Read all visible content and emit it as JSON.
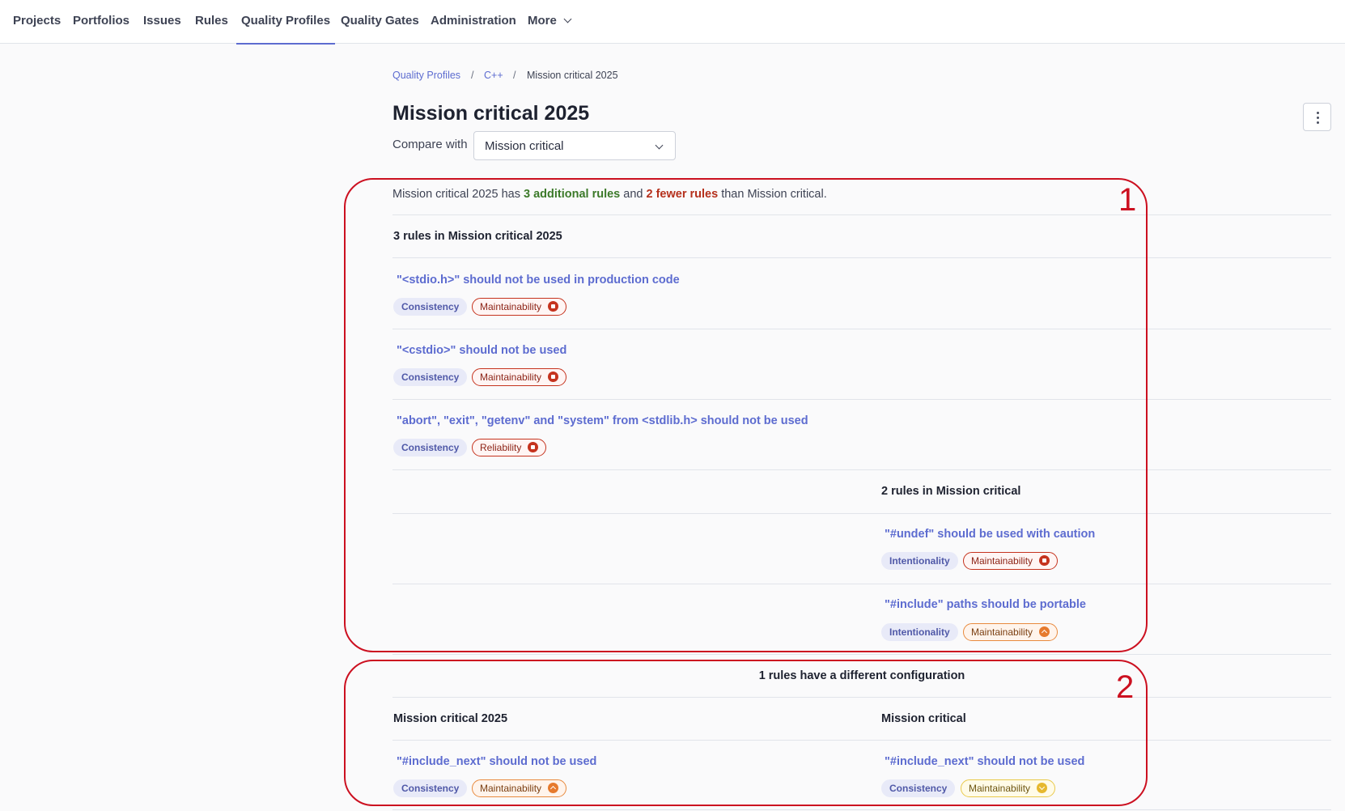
{
  "nav": {
    "items": [
      "Projects",
      "Portfolios",
      "Issues",
      "Rules",
      "Quality Profiles",
      "Quality Gates",
      "Administration",
      "More"
    ],
    "active": "Quality Profiles"
  },
  "breadcrumb": [
    "Quality Profiles",
    "C++",
    "Mission critical 2025"
  ],
  "title": "Mission critical 2025",
  "compare": {
    "label": "Compare with",
    "value": "Mission critical"
  },
  "summary": {
    "prefix": "Mission critical 2025 has ",
    "additional": "3 additional rules",
    "middle": " and ",
    "fewer": "2 fewer rules",
    "suffix": " than Mission critical."
  },
  "left_section": {
    "heading": "3 rules in Mission critical 2025",
    "rules": [
      {
        "name": "\"<stdio.h>\" should not be used in production code",
        "category": "Consistency",
        "quality": "Maintainability",
        "severity": "high"
      },
      {
        "name": "\"<cstdio>\" should not be used",
        "category": "Consistency",
        "quality": "Maintainability",
        "severity": "high"
      },
      {
        "name": "\"abort\", \"exit\", \"getenv\" and \"system\" from <stdlib.h> should not be used",
        "category": "Consistency",
        "quality": "Reliability",
        "severity": "high"
      }
    ]
  },
  "right_section": {
    "heading": "2 rules in Mission critical",
    "rules": [
      {
        "name": "\"#undef\" should be used with caution",
        "category": "Intentionality",
        "quality": "Maintainability",
        "severity": "high"
      },
      {
        "name": "\"#include\" paths should be portable",
        "category": "Intentionality",
        "quality": "Maintainability",
        "severity": "medium"
      }
    ]
  },
  "diff_section": {
    "heading": "1 rules have a different configuration",
    "left_heading": "Mission critical 2025",
    "right_heading": "Mission critical",
    "left_rule": {
      "name": "\"#include_next\" should not be used",
      "category": "Consistency",
      "quality": "Maintainability",
      "severity": "medium"
    },
    "right_rule": {
      "name": "\"#include_next\" should not be used",
      "category": "Consistency",
      "quality": "Maintainability",
      "severity": "low"
    }
  },
  "annotations": [
    "1",
    "2"
  ],
  "colors": {
    "accent": "#5d6cd0",
    "annotation": "#cc1020",
    "added": "#3c7a2a",
    "removed": "#b5301c"
  }
}
